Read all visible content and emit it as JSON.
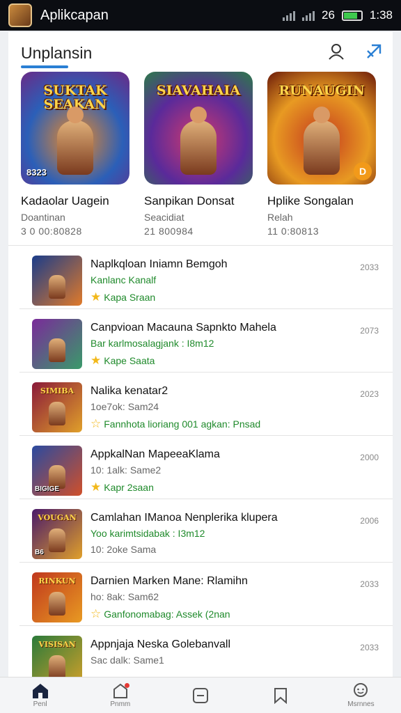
{
  "status_bar": {
    "app_name": "Aplikcapan",
    "network": "26",
    "time": "1:38",
    "battery_level": 0.75
  },
  "header": {
    "title": "Unplansin"
  },
  "featured": [
    {
      "art_title": "SUKTAK SEAKAN",
      "badge": "8323",
      "name": "Kadaolar Uagein",
      "subtitle": "Doantinan",
      "downloads": "3 0 00:80828",
      "art_colors": [
        "#2b5fb8",
        "#f08a24",
        "#6a2a86"
      ]
    },
    {
      "art_title": "SIAVAHAIA",
      "badge": "",
      "name": "Sanpikan Donsat",
      "subtitle": "Seacidiat",
      "downloads": "21 800984",
      "art_colors": [
        "#5a2a9a",
        "#d23a6e",
        "#2d7a4a"
      ]
    },
    {
      "art_title": "RUNAUGIN",
      "badge": "D",
      "name": "Hplike Songalan",
      "subtitle": "Relah",
      "downloads": "11 0:80813",
      "art_colors": [
        "#e89a22",
        "#c3381e",
        "#6b1a0a"
      ]
    }
  ],
  "apps": [
    {
      "name": "Naplkqloan Iniamn Bemgoh",
      "line2": "Kanlanc Kanalf",
      "line2_style": "green",
      "line3": "Kapa Sraan",
      "line3_style": "green",
      "star": "filled",
      "meta": "2033",
      "thumb_title": "",
      "thumb_badge": "",
      "thumb_colors": [
        "#1a3c8a",
        "#e07a2a"
      ]
    },
    {
      "name": "Canpvioan Macauna Sapnkto Mahela",
      "line2": "Bar karlmosalagjank : I8m12",
      "line2_style": "green",
      "line3": "Kape Saata",
      "line3_style": "green",
      "star": "filled",
      "meta": "2073",
      "thumb_title": "",
      "thumb_badge": "",
      "thumb_colors": [
        "#7a2a9a",
        "#3a9a6a"
      ]
    },
    {
      "name": "Nalika kenatar2",
      "line2": "1oe7ok: Sam24",
      "line2_style": "grey",
      "line3": "Fannhota lioriang 001 agkan: Pnsad",
      "line3_style": "green",
      "star": "outline",
      "meta": "2023",
      "thumb_title": "SIMIBA",
      "thumb_badge": "",
      "thumb_colors": [
        "#8a1a3a",
        "#e0a02a"
      ]
    },
    {
      "name": "AppkalNan MapeeaKlama",
      "line2": "10: 1alk: Same2",
      "line2_style": "grey",
      "line3": "Kapr 2saan",
      "line3_style": "green",
      "star": "filled",
      "meta": "2000",
      "thumb_title": "",
      "thumb_badge": "BIGIGE",
      "thumb_colors": [
        "#2a4aa0",
        "#d0502a"
      ]
    },
    {
      "name": "Camlahan IManoa Nenplerika klupera",
      "line2": "Yoo karimtsidabak : I3m12",
      "line2_style": "green",
      "line3": "10: 2oke Sama",
      "line3_style": "grey",
      "star": "",
      "meta": "2006",
      "thumb_title": "VOUGAN",
      "thumb_badge": "B6",
      "thumb_colors": [
        "#4a1a6a",
        "#e0a02a"
      ]
    },
    {
      "name": "Darnien Marken Mane: Rlamihn",
      "line2": "ho: 8ak: Sam62",
      "line2_style": "grey",
      "line3": "Ganfonomabag: Assek (2nan",
      "line3_style": "green",
      "star": "outline",
      "meta": "2033",
      "thumb_title": "RINKUN",
      "thumb_badge": "",
      "thumb_colors": [
        "#c0381e",
        "#e89a22"
      ]
    },
    {
      "name": "Appnjaja Neska Golebanvall",
      "line2": "Sac dalk: Same1",
      "line2_style": "grey",
      "line3": "",
      "line3_style": "grey",
      "star": "",
      "meta": "2033",
      "thumb_title": "VISISAN",
      "thumb_badge": "",
      "thumb_colors": [
        "#2a7a3a",
        "#d0a02a"
      ]
    }
  ],
  "bottom_nav": [
    {
      "label": "Penl",
      "icon": "home-icon",
      "active": true
    },
    {
      "label": "Pnmm",
      "icon": "store-icon",
      "active": false,
      "notification": true
    },
    {
      "label": "",
      "icon": "minus-box-icon",
      "active": false
    },
    {
      "label": "",
      "icon": "bookmark-icon",
      "active": false
    },
    {
      "label": "Msrnnes",
      "icon": "chat-icon",
      "active": false
    }
  ]
}
